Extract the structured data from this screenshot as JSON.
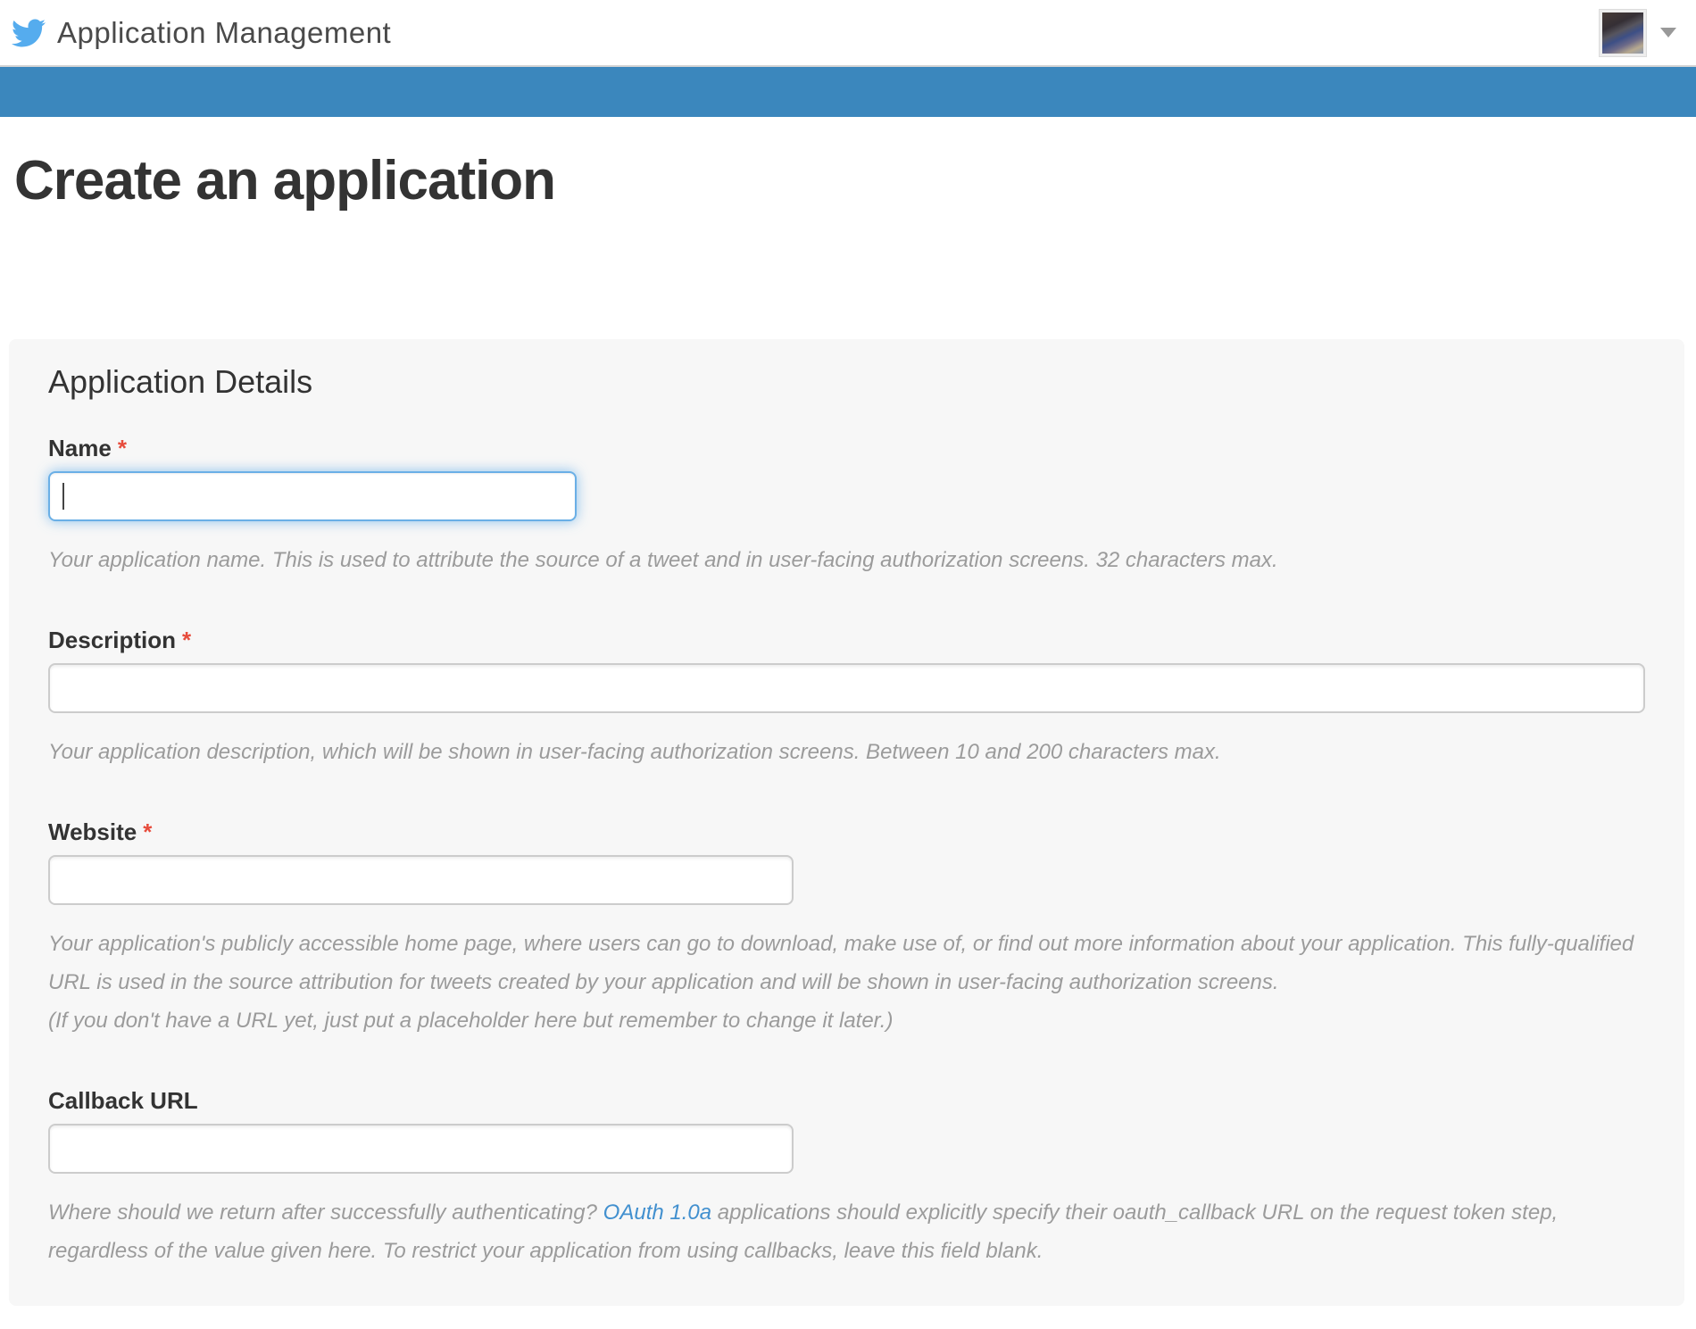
{
  "header": {
    "app_title": "Application Management",
    "logo_icon": "twitter-bird-icon",
    "avatar_icon": "user-avatar-photo",
    "caret_icon": "chevron-down-icon"
  },
  "page": {
    "title": "Create an application"
  },
  "panel": {
    "title": "Application Details",
    "required_marker": "*",
    "fields": {
      "name": {
        "label": "Name",
        "required": true,
        "value": "",
        "help": "Your application name. This is used to attribute the source of a tweet and in user-facing authorization screens. 32 characters max."
      },
      "description": {
        "label": "Description",
        "required": true,
        "value": "",
        "help": "Your application description, which will be shown in user-facing authorization screens. Between 10 and 200 characters max."
      },
      "website": {
        "label": "Website",
        "required": true,
        "value": "",
        "help_para": "Your application's publicly accessible home page, where users can go to download, make use of, or find out more information about your application. This fully-qualified URL is used in the source attribution for tweets created by your application and will be shown in user-facing authorization screens.",
        "help_note": "(If you don't have a URL yet, just put a placeholder here but remember to change it later.)"
      },
      "callback": {
        "label": "Callback URL",
        "required": false,
        "value": "",
        "help_prefix": "Where should we return after successfully authenticating?",
        "help_link": "OAuth 1.0a",
        "help_suffix": "applications should explicitly specify their oauth_callback URL on the request token step, regardless of the value given here. To restrict your application from using callbacks, leave this field blank."
      }
    }
  },
  "colors": {
    "blue_bar": "#3b87bd",
    "twitter_blue": "#55acee",
    "link_blue": "#4290cf",
    "required_red": "#e74c3c",
    "panel_bg": "#f7f7f7",
    "focus_glow": "#66afe9"
  }
}
